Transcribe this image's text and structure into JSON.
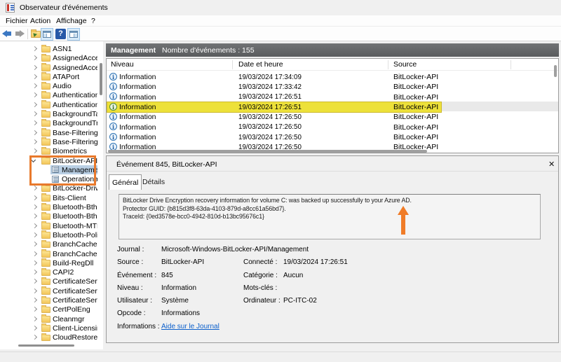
{
  "window": {
    "title": "Observateur d'événements"
  },
  "menu": {
    "items": [
      "Fichier",
      "Action",
      "Affichage",
      "?"
    ]
  },
  "toolbar": {
    "icons": [
      "back",
      "forward",
      "open-folder",
      "show-console-tree",
      "help",
      "show-action-pane"
    ]
  },
  "tree": {
    "items": [
      {
        "label": "ASN1",
        "depth": 0,
        "state": "collapsed",
        "icon": "folder",
        "selected": false
      },
      {
        "label": "AssignedAcces",
        "depth": 0,
        "state": "collapsed",
        "icon": "folder",
        "selected": false
      },
      {
        "label": "AssignedAcces",
        "depth": 0,
        "state": "collapsed",
        "icon": "folder",
        "selected": false
      },
      {
        "label": "ATAPort",
        "depth": 0,
        "state": "collapsed",
        "icon": "folder",
        "selected": false
      },
      {
        "label": "Audio",
        "depth": 0,
        "state": "collapsed",
        "icon": "folder",
        "selected": false
      },
      {
        "label": "Authentication",
        "depth": 0,
        "state": "collapsed",
        "icon": "folder",
        "selected": false
      },
      {
        "label": "Authentication",
        "depth": 0,
        "state": "collapsed",
        "icon": "folder",
        "selected": false
      },
      {
        "label": "BackgroundTa",
        "depth": 0,
        "state": "collapsed",
        "icon": "folder",
        "selected": false
      },
      {
        "label": "BackgroundTra",
        "depth": 0,
        "state": "collapsed",
        "icon": "folder",
        "selected": false
      },
      {
        "label": "Base-Filtering-",
        "depth": 0,
        "state": "collapsed",
        "icon": "folder",
        "selected": false
      },
      {
        "label": "Base-Filtering-",
        "depth": 0,
        "state": "collapsed",
        "icon": "folder",
        "selected": false
      },
      {
        "label": "Biometrics",
        "depth": 0,
        "state": "collapsed",
        "icon": "folder",
        "selected": false
      },
      {
        "label": "BitLocker-API",
        "depth": 0,
        "state": "expanded",
        "icon": "folder",
        "selected": false
      },
      {
        "label": "Management",
        "depth": 1,
        "state": "none",
        "icon": "log",
        "selected": true
      },
      {
        "label": "Operational",
        "depth": 1,
        "state": "none",
        "icon": "log",
        "selected": false
      },
      {
        "label": "BitLocker-Driv",
        "depth": 0,
        "state": "collapsed",
        "icon": "folder",
        "selected": false
      },
      {
        "label": "Bits-Client",
        "depth": 0,
        "state": "collapsed",
        "icon": "folder",
        "selected": false
      },
      {
        "label": "Bluetooth-Bth",
        "depth": 0,
        "state": "collapsed",
        "icon": "folder",
        "selected": false
      },
      {
        "label": "Bluetooth-Bth",
        "depth": 0,
        "state": "collapsed",
        "icon": "folder",
        "selected": false
      },
      {
        "label": "Bluetooth-MTP",
        "depth": 0,
        "state": "collapsed",
        "icon": "folder",
        "selected": false
      },
      {
        "label": "Bluetooth-Poli",
        "depth": 0,
        "state": "collapsed",
        "icon": "folder",
        "selected": false
      },
      {
        "label": "BranchCache",
        "depth": 0,
        "state": "collapsed",
        "icon": "folder",
        "selected": false
      },
      {
        "label": "BranchCacheS",
        "depth": 0,
        "state": "collapsed",
        "icon": "folder",
        "selected": false
      },
      {
        "label": "Build-RegDll",
        "depth": 0,
        "state": "collapsed",
        "icon": "folder",
        "selected": false
      },
      {
        "label": "CAPI2",
        "depth": 0,
        "state": "collapsed",
        "icon": "folder",
        "selected": false
      },
      {
        "label": "CertificateServ",
        "depth": 0,
        "state": "collapsed",
        "icon": "folder",
        "selected": false
      },
      {
        "label": "CertificateServ",
        "depth": 0,
        "state": "collapsed",
        "icon": "folder",
        "selected": false
      },
      {
        "label": "CertificateServ",
        "depth": 0,
        "state": "collapsed",
        "icon": "folder",
        "selected": false
      },
      {
        "label": "CertPolEng",
        "depth": 0,
        "state": "collapsed",
        "icon": "folder",
        "selected": false
      },
      {
        "label": "Cleanmgr",
        "depth": 0,
        "state": "collapsed",
        "icon": "folder",
        "selected": false
      },
      {
        "label": "Client-Licensin",
        "depth": 0,
        "state": "collapsed",
        "icon": "folder",
        "selected": false
      },
      {
        "label": "CloudRestoreL",
        "depth": 0,
        "state": "collapsed",
        "icon": "folder",
        "selected": false
      }
    ]
  },
  "events": {
    "title": "Management",
    "count_label": "Nombre d'événements : 155",
    "columns": [
      "Niveau",
      "Date et heure",
      "Source"
    ],
    "rows": [
      {
        "level": "Information",
        "date": "19/03/2024 17:34:09",
        "source": "BitLocker-API",
        "highlighted": false,
        "selected": false
      },
      {
        "level": "Information",
        "date": "19/03/2024 17:33:42",
        "source": "BitLocker-API",
        "highlighted": false,
        "selected": false
      },
      {
        "level": "Information",
        "date": "19/03/2024 17:26:51",
        "source": "BitLocker-API",
        "highlighted": false,
        "selected": false
      },
      {
        "level": "Information",
        "date": "19/03/2024 17:26:51",
        "source": "BitLocker-API",
        "highlighted": true,
        "selected": true
      },
      {
        "level": "Information",
        "date": "19/03/2024 17:26:50",
        "source": "BitLocker-API",
        "highlighted": false,
        "selected": false
      },
      {
        "level": "Information",
        "date": "19/03/2024 17:26:50",
        "source": "BitLocker-API",
        "highlighted": false,
        "selected": false
      },
      {
        "level": "Information",
        "date": "19/03/2024 17:26:50",
        "source": "BitLocker-API",
        "highlighted": false,
        "selected": false
      },
      {
        "level": "Information",
        "date": "19/03/2024 17:26:50",
        "source": "BitLocker-API",
        "highlighted": false,
        "selected": false
      }
    ]
  },
  "detail": {
    "title": "Événement 845, BitLocker-API",
    "tabs": [
      "Général",
      "Détails"
    ],
    "message_line1": "BitLocker Drive Encryption recovery information for volume C: was backed up successfully to your Azure AD.",
    "message_line2": "Protector GUID: {b815d3f8-63da-4103-879d-a8cc61a56bd7}.",
    "message_line3": "TraceId: {0ed3578e-bcc0-4942-810d-b13bc95676c1}",
    "fields": {
      "journal_label": "Journal :",
      "journal": "Microsoft-Windows-BitLocker-API/Management",
      "source_label": "Source :",
      "source": "BitLocker-API",
      "connected_label": "Connecté :",
      "connected": "19/03/2024 17:26:51",
      "event_label": "Événement :",
      "event": "845",
      "category_label": "Catégorie :",
      "category": "Aucun",
      "level_label": "Niveau :",
      "level": "Information",
      "keywords_label": "Mots-clés :",
      "keywords": "",
      "user_label": "Utilisateur :",
      "user": "Système",
      "computer_label": "Ordinateur :",
      "computer": "PC-ITC-02",
      "opcode_label": "Opcode :",
      "opcode": "Informations",
      "info_label": "Informations :",
      "info_link": "Aide sur le Journal"
    }
  },
  "annotations": {
    "highlight_color": "#ede13a",
    "rect_color": "#e8792c",
    "arrow_color": "#f07c28"
  }
}
